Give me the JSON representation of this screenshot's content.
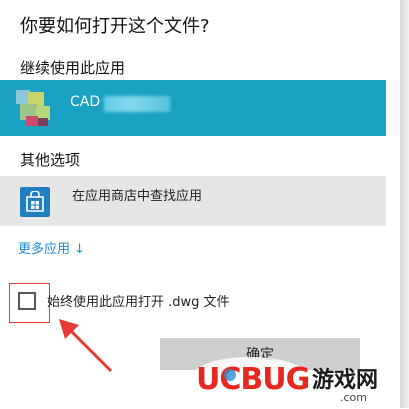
{
  "dialog": {
    "title": "你要如何打开这个文件?",
    "continue_section": "继续使用此应用",
    "current_app": {
      "label": "CAD",
      "icon": "cad-app-icon"
    },
    "other_section": "其他选项",
    "store_option": {
      "label": "在应用商店中查找应用",
      "icon": "store-icon"
    },
    "more_apps": "更多应用 ↓",
    "always_use": {
      "label": "始终使用此应用打开 .dwg 文件",
      "checked": false
    },
    "ok_label": "确定"
  },
  "annotation": {
    "arrow": "red-arrow-icon",
    "color": "#e53935"
  },
  "watermark": {
    "brand": "UCBUG",
    "text": "游戏网",
    "url": ".com"
  },
  "colors": {
    "accent": "#1aa1c4",
    "link": "#1a8ccf",
    "store": "#1f7fc0"
  }
}
